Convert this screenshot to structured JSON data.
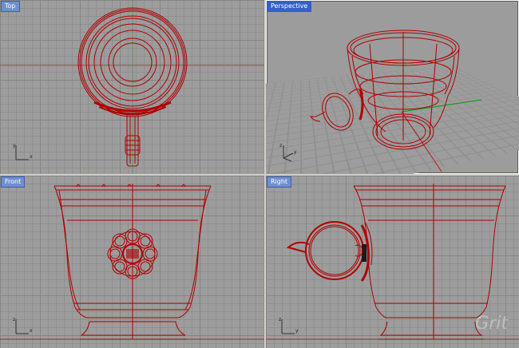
{
  "viewports": {
    "top": {
      "label": "Top"
    },
    "perspective": {
      "label": "Perspective"
    },
    "front": {
      "label": "Front"
    },
    "right": {
      "label": "Right"
    }
  },
  "axes": {
    "top": {
      "v": "y",
      "h": "x"
    },
    "perspective": {
      "v": "z",
      "h": "y"
    },
    "front": {
      "v": "z",
      "h": "x"
    },
    "right": {
      "v": "z",
      "h": "y"
    }
  },
  "watermark": {
    "text": "Grit"
  },
  "colors": {
    "wire": "#b00000",
    "grid": "#8f8f8f",
    "background": "#9c9c9c",
    "label_bg": "#6f8fcf",
    "x_axis": "#c00000",
    "y_axis": "#00a000"
  }
}
